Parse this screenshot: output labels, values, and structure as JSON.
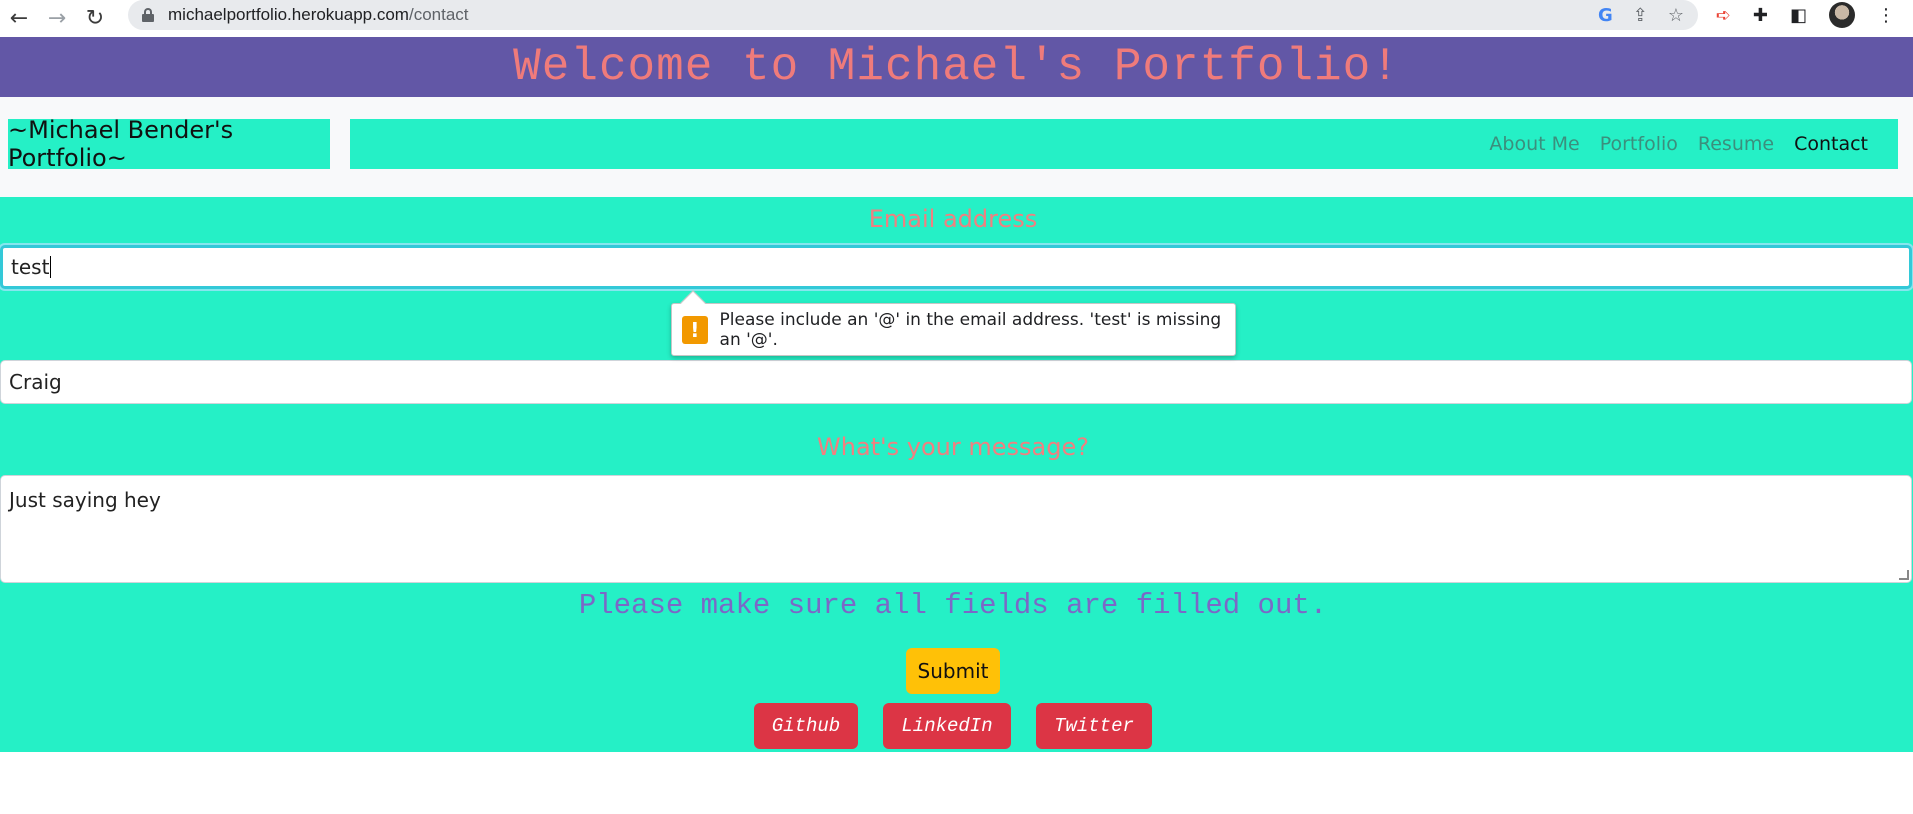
{
  "browser": {
    "url_host": "michaelportfolio.herokuapp.com",
    "url_path": "/contact",
    "back_glyph": "←",
    "forward_glyph": "→",
    "reload_glyph": "↻",
    "google_glyph": "G",
    "share_glyph": "⇪",
    "star_glyph": "☆",
    "ext1_glyph": "➪",
    "puzzle_glyph": "✚",
    "sidepanel_glyph": "◧",
    "menu_glyph": "⋮"
  },
  "header": {
    "title": "Welcome to Michael's Portfolio!"
  },
  "navbar": {
    "brand": "~Michael Bender's Portfolio~",
    "links": [
      "About Me",
      "Portfolio",
      "Resume",
      "Contact"
    ],
    "active": "Contact"
  },
  "form": {
    "email_label": "Email address",
    "email_value": "test",
    "name_value": "Craig",
    "message_label": "What's your message?",
    "message_value": "Just saying hey",
    "notice": "Please make sure all fields are filled out.",
    "submit_label": "Submit"
  },
  "tooltip": {
    "icon_glyph": "!",
    "text": "Please include an '@' in the email address. 'test' is missing an '@'."
  },
  "social": {
    "github": "Github",
    "linkedin": "LinkedIn",
    "twitter": "Twitter"
  },
  "colors": {
    "header_bg": "#6257a6",
    "header_text": "#ef7b7b",
    "accent_bg": "#25f0c6",
    "label_text": "#f08080",
    "notice_text": "#7b68c7",
    "submit_bg": "#ffc107",
    "social_bg": "#dc3545"
  }
}
